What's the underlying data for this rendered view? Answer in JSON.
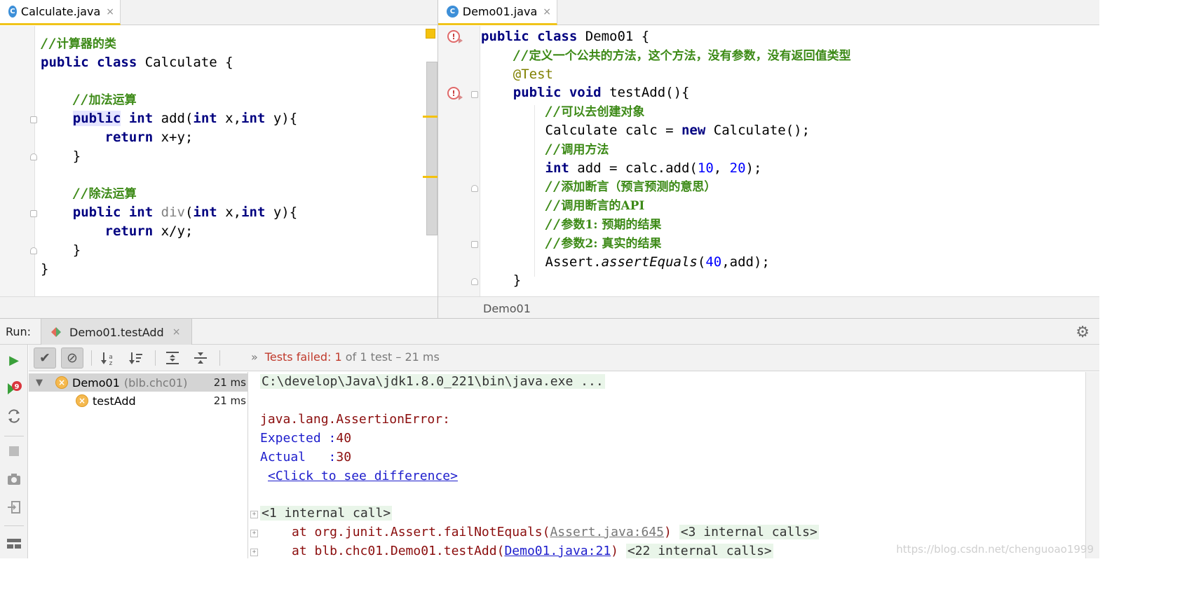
{
  "left_editor": {
    "tab": {
      "icon": "C",
      "label": "Calculate.java",
      "close": "×"
    },
    "code": [
      {
        "type": "comment",
        "prefix": "//",
        "text": "计算器的类"
      },
      {
        "type": "class_decl",
        "kw1": "public",
        "kw2": "class",
        "rest": " Calculate {"
      },
      {
        "type": "blank"
      },
      {
        "type": "comment",
        "prefix": "//",
        "text": "加法运算",
        "indent": "    "
      },
      {
        "type": "method",
        "indent": "    ",
        "kw1": "public",
        "kw2": "int",
        "name": " add(",
        "kw3": "int",
        "p1": " x,",
        "kw4": "int",
        "p2": " y){"
      },
      {
        "type": "return",
        "indent": "        ",
        "kw": "return",
        "rest": " x+y;"
      },
      {
        "type": "plain",
        "text": "    }"
      },
      {
        "type": "blank"
      },
      {
        "type": "comment",
        "prefix": "//",
        "text": "除法运算",
        "indent": "    "
      },
      {
        "type": "method_gray",
        "indent": "    ",
        "kw1": "public",
        "kw2": "int",
        "name": "div",
        "open": "(",
        "kw3": "int",
        "p1": " x,",
        "kw4": "int",
        "p2": " y){"
      },
      {
        "type": "return",
        "indent": "        ",
        "kw": "return",
        "rest": " x/y;"
      },
      {
        "type": "plain",
        "text": "    }"
      },
      {
        "type": "plain",
        "text": "}"
      }
    ]
  },
  "right_editor": {
    "tab": {
      "icon": "C",
      "label": "Demo01.java",
      "close": "×"
    },
    "breadcrumb": "Demo01",
    "code": [
      {
        "type": "class_decl",
        "kw1": "public",
        "kw2": "class",
        "rest": " Demo01 {"
      },
      {
        "type": "comment",
        "indent": "    ",
        "prefix": "//",
        "text": "定义一个公共的方法，这个方法，没有参数，没有返回值类型"
      },
      {
        "type": "annotation",
        "indent": "    ",
        "text": "@Test"
      },
      {
        "type": "method_void",
        "indent": "    ",
        "kw1": "public",
        "kw2": "void",
        "rest": " testAdd(){"
      },
      {
        "type": "comment",
        "indent": "        ",
        "prefix": "//",
        "text": "可以去创建对象"
      },
      {
        "type": "new_stmt",
        "indent": "        ",
        "pre": "Calculate calc = ",
        "kw": "new",
        "post": " Calculate();"
      },
      {
        "type": "comment",
        "indent": "        ",
        "prefix": "//",
        "text": "调用方法"
      },
      {
        "type": "int_stmt",
        "indent": "        ",
        "kw": "int",
        "pre": " add = calc.add(",
        "n1": "10",
        "mid": ", ",
        "n2": "20",
        "post": ");"
      },
      {
        "type": "comment",
        "indent": "        ",
        "prefix": "//",
        "text": "添加断言（预言预测的意思）"
      },
      {
        "type": "comment",
        "indent": "        ",
        "prefix": "//",
        "text": "调用断言的API"
      },
      {
        "type": "comment",
        "indent": "        ",
        "prefix": "//",
        "text": "参数1: 预期的结果"
      },
      {
        "type": "comment",
        "indent": "        ",
        "prefix": "//",
        "text": "参数2: 真实的结果"
      },
      {
        "type": "assert_stmt",
        "indent": "        ",
        "pre": "Assert.",
        "call": "assertEquals",
        "open": "(",
        "n": "40",
        "post": ",add);"
      },
      {
        "type": "plain",
        "text": "    }"
      }
    ]
  },
  "run": {
    "label": "Run:",
    "tab_label": "Demo01.testAdd",
    "tab_close": "×",
    "status": {
      "chevron": "»",
      "failed_label": "Tests failed: ",
      "failed_count": "1",
      "rest": " of 1 test – 21 ms"
    },
    "tree": [
      {
        "name": "Demo01",
        "sub": "(blb.chc01)",
        "time": "21 ms",
        "selected": true
      },
      {
        "name": "testAdd",
        "sub": "",
        "time": "21 ms",
        "selected": false
      }
    ],
    "console": {
      "command": "C:\\develop\\Java\\jdk1.8.0_221\\bin\\java.exe ...",
      "error": "java.lang.AssertionError:",
      "expected_label": "Expected :",
      "expected_value": "40",
      "actual_label": "Actual   :",
      "actual_value": "30",
      "diff_link": "<Click to see difference>",
      "internal_call": "<1 internal call>",
      "trace1_pre": "at org.junit.Assert.failNotEquals(",
      "trace1_link": "Assert.java:645",
      "trace1_post": ")",
      "trace1_internal": "<3 internal calls>",
      "trace2_pre": "at blb.chc01.Demo01.testAdd(",
      "trace2_link": "Demo01.java:21",
      "trace2_post": ")",
      "trace2_internal": "<22 internal calls>"
    },
    "watermark": "https://blog.csdn.net/chenguoao1999"
  },
  "colors": {
    "keyword": "#000080",
    "comment": "#3d8a17",
    "annotation": "#808000",
    "number": "#0000ff",
    "error_text": "#8b0d0d",
    "failed_status": "#c0392b",
    "run_green": "#3aa03a",
    "fail_icon": "#f5b94f",
    "tab_accent": "#f0c419"
  },
  "icons": {
    "run_tab": "junit-icon",
    "settings": "gear-icon",
    "rerun": "play-icon",
    "rerun_failed": "rerun-failed-icon",
    "toggle_auto_test": "auto-test-icon",
    "stop": "stop-icon",
    "screenshot": "camera-icon",
    "exit": "exit-icon",
    "layout": "layout-icon",
    "show_passed": "check-icon",
    "show_ignored": "ignored-icon",
    "sort_alpha": "sort-alpha-icon",
    "sort_duration": "sort-duration-icon",
    "expand_all": "expand-all-icon",
    "collapse_all": "collapse-all-icon"
  }
}
